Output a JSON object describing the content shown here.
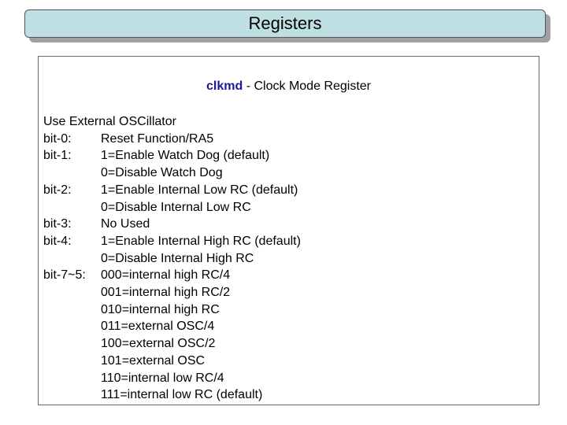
{
  "title": "Registers",
  "register": {
    "name": "clkmd",
    "separator": " - ",
    "description": "Clock Mode Register"
  },
  "intro": "Use External OSCillator",
  "rows": [
    {
      "label": "bit-0:",
      "value": "Reset Function/RA5"
    },
    {
      "label": "bit-1:",
      "value": "1=Enable Watch Dog (default)"
    },
    {
      "label": "",
      "value": "0=Disable Watch Dog"
    },
    {
      "label": "bit-2:",
      "value": "1=Enable Internal Low RC (default)"
    },
    {
      "label": "",
      "value": "0=Disable Internal Low RC"
    },
    {
      "label": "bit-3:",
      "value": "No Used"
    },
    {
      "label": "bit-4:",
      "value": "1=Enable Internal High RC (default)"
    },
    {
      "label": "",
      "value": "0=Disable Internal High RC"
    },
    {
      "label": "bit-7~5:",
      "value": "000=internal high RC/4"
    },
    {
      "label": "",
      "value": "001=internal high RC/2"
    },
    {
      "label": "",
      "value": "010=internal high RC"
    },
    {
      "label": "",
      "value": "011=external OSC/4"
    },
    {
      "label": "",
      "value": "100=external OSC/2"
    },
    {
      "label": "",
      "value": "101=external OSC"
    },
    {
      "label": "",
      "value": "110=internal low RC/4"
    },
    {
      "label": "",
      "value": "111=internal low RC (default)"
    }
  ]
}
